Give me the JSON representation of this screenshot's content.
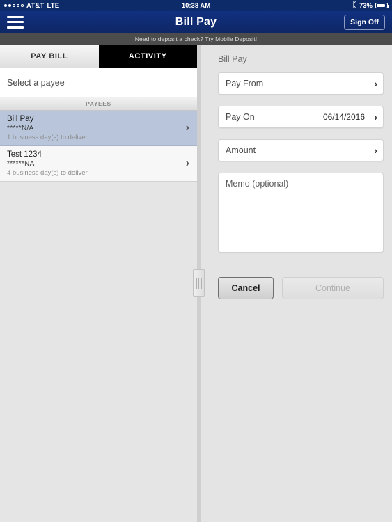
{
  "statusbar": {
    "carrier": "AT&T",
    "network": "LTE",
    "signal_bars_filled": 2,
    "signal_bars_total": 5,
    "time": "10:38 AM",
    "bluetooth_icon": "bluetooth-icon",
    "battery_percent": "73%",
    "battery_level": 73
  },
  "navbar": {
    "menu_icon": "hamburger-menu-icon",
    "title": "Bill Pay",
    "signoff_label": "Sign Off"
  },
  "promo": {
    "message": "Need to deposit a check?  Try Mobile Deposit!"
  },
  "tabs": [
    {
      "label": "PAY BILL",
      "active": true
    },
    {
      "label": "ACTIVITY",
      "active": false
    }
  ],
  "left_panel": {
    "select_prompt": "Select a payee",
    "section_header": "PAYEES",
    "payees": [
      {
        "name": "Bill Pay",
        "account": "*****N/A",
        "delivery": "1 business day(s) to deliver",
        "selected": true,
        "chevron": "›"
      },
      {
        "name": "Test 1234",
        "account": "******NA",
        "delivery": "4 business day(s) to deliver",
        "selected": false,
        "chevron": "›"
      }
    ]
  },
  "right_panel": {
    "title": "Bill Pay",
    "fields": [
      {
        "label": "Pay From",
        "value": "",
        "chevron": "›"
      },
      {
        "label": "Pay On",
        "value": "06/14/2016",
        "chevron": "›"
      },
      {
        "label": "Amount",
        "value": "",
        "chevron": "›"
      }
    ],
    "memo_placeholder": "Memo (optional)",
    "memo_value": "",
    "cancel_label": "Cancel",
    "continue_label": "Continue",
    "continue_enabled": false
  },
  "divider": {
    "grip_icon": "drag-handle-icon"
  },
  "colors": {
    "navy": "#113080",
    "navy_dark": "#0d2b68",
    "promo_bar": "#4c4c4c",
    "selected_row": "#b8c5da",
    "panel_bg": "#e4e4e4",
    "tab_active_text": "#333333",
    "tab_inactive_bg": "#000000"
  }
}
